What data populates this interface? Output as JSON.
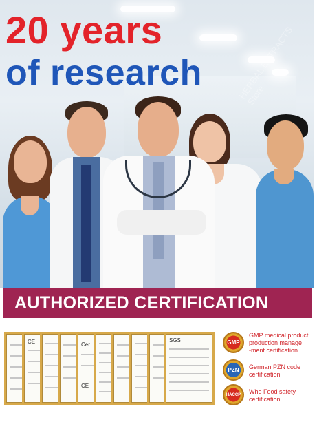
{
  "headline": {
    "line1": "20 years",
    "line2": "of research"
  },
  "watermark": "HERBAL EXTRACTS Store",
  "banner": {
    "text": "AUTHORIZED CERTIFICATION"
  },
  "certificates": {
    "count": 10
  },
  "badges": [
    {
      "seal": "GMP",
      "text": "GMP medical product\nproduction manage\n-ment certification"
    },
    {
      "seal": "PZN",
      "text": "German PZN code\ncertification"
    },
    {
      "seal": "HACCP",
      "text": "Who Food safety\ncertification"
    }
  ],
  "colors": {
    "headline_red": "#e3232a",
    "headline_blue": "#1f56b8",
    "banner": "#9f2452",
    "badge_text": "#d1262c"
  }
}
